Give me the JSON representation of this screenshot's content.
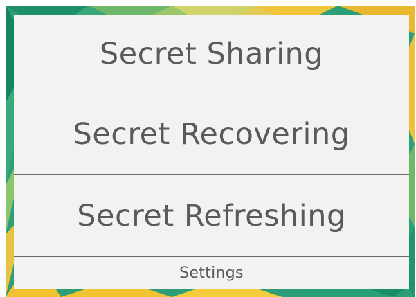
{
  "menu": {
    "items": [
      {
        "label": "Secret Sharing"
      },
      {
        "label": "Secret Recovering"
      },
      {
        "label": "Secret Refreshing"
      }
    ],
    "settings_label": "Settings"
  },
  "colors": {
    "panel_background": "#f2f2f0",
    "text": "#5a5a5a",
    "divider": "#6a6a6a",
    "background_green": "#2aa077",
    "background_yellow": "#f2c230"
  }
}
